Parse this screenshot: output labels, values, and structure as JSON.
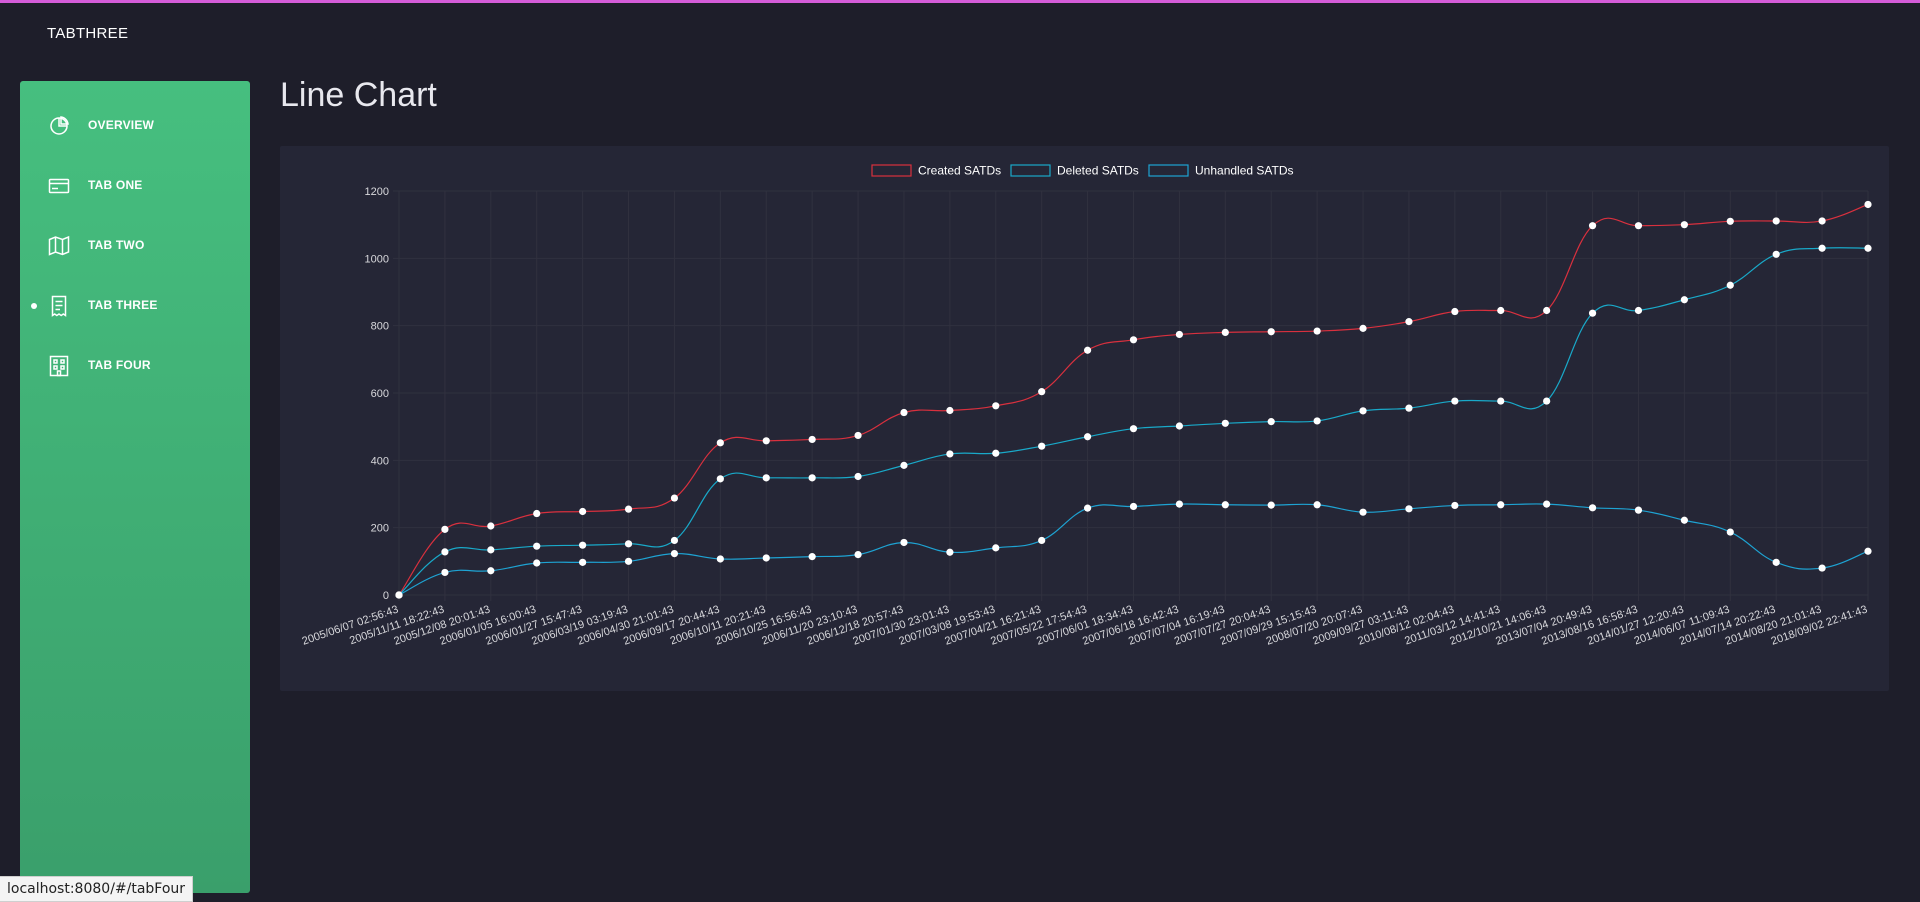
{
  "app": {
    "brand": "TABTHREE"
  },
  "sidebar": {
    "items": [
      {
        "label": "OVERVIEW",
        "icon": "pie-chart-icon",
        "active": false
      },
      {
        "label": "TAB ONE",
        "icon": "credit-card-icon",
        "active": false
      },
      {
        "label": "TAB TWO",
        "icon": "map-icon",
        "active": false
      },
      {
        "label": "TAB THREE",
        "icon": "receipt-icon",
        "active": true
      },
      {
        "label": "TAB FOUR",
        "icon": "building-icon",
        "active": false
      }
    ]
  },
  "main": {
    "title": "Line Chart"
  },
  "statusbar": {
    "url": "localhost:8080/#/tabFour"
  },
  "colors": {
    "background": "#1e1e2a",
    "card": "#252636",
    "sidebar_top": "#46bf7f",
    "sidebar_bottom": "#3a9f6b",
    "created": "#d9303e",
    "deleted": "#19a9c9",
    "unhandled": "#1ea3d3",
    "point": "#ffffff",
    "grid": "#30313f",
    "tick": "#d8d8dc"
  },
  "chart_data": {
    "type": "line",
    "title": "",
    "xlabel": "",
    "ylabel": "",
    "ylim": [
      0,
      1200
    ],
    "y_ticks": [
      0,
      200,
      400,
      600,
      800,
      1000,
      1200
    ],
    "grid": true,
    "legend_position": "top-center",
    "x": [
      "2005/06/07 02:56:43",
      "2005/11/11 18:22:43",
      "2005/12/08 20:01:43",
      "2006/01/05 16:00:43",
      "2006/01/27 15:47:43",
      "2006/03/19 03:19:43",
      "2006/04/30 21:01:43",
      "2006/09/17 20:44:43",
      "2006/10/11 20:21:43",
      "2006/10/25 16:56:43",
      "2006/11/20 23:10:43",
      "2006/12/18 20:57:43",
      "2007/01/30 23:01:43",
      "2007/03/08 19:53:43",
      "2007/04/21 16:21:43",
      "2007/05/22 17:54:43",
      "2007/06/01 18:34:43",
      "2007/06/18 16:42:43",
      "2007/07/04 16:19:43",
      "2007/07/27 20:04:43",
      "2007/09/29 15:15:43",
      "2008/07/20 20:07:43",
      "2009/09/27 03:11:43",
      "2010/08/12 02:04:43",
      "2011/03/12 14:41:43",
      "2012/10/21 14:06:43",
      "2013/07/04 20:49:43",
      "2013/08/16 16:58:43",
      "2014/01/27 12:20:43",
      "2014/06/07 11:09:43",
      "2014/07/14 20:22:43",
      "2014/08/20 21:01:43",
      "2018/09/02 22:41:43"
    ],
    "series": [
      {
        "name": "Created SATDs",
        "color": "#d9303e",
        "values": [
          0,
          195,
          205,
          242,
          248,
          255,
          288,
          452,
          458,
          462,
          474,
          542,
          548,
          562,
          604,
          727,
          758,
          774,
          780,
          782,
          784,
          792,
          812,
          842,
          845,
          845,
          1097,
          1097,
          1100,
          1110,
          1111,
          1111,
          1160
        ]
      },
      {
        "name": "Deleted SATDs",
        "color": "#19a9c9",
        "values": [
          0,
          128,
          134,
          145,
          148,
          152,
          162,
          345,
          348,
          348,
          352,
          385,
          419,
          421,
          442,
          470,
          494,
          502,
          510,
          515,
          517,
          547,
          555,
          576,
          576,
          576,
          837,
          845,
          877,
          920,
          1012,
          1030,
          1030
        ]
      },
      {
        "name": "Unhandled  SATDs",
        "color": "#1ea3d3",
        "values": [
          0,
          67,
          72,
          95,
          97,
          100,
          123,
          107,
          110,
          114,
          120,
          156,
          127,
          140,
          162,
          258,
          263,
          270,
          268,
          267,
          268,
          246,
          256,
          266,
          268,
          270,
          259,
          252,
          222,
          187,
          97,
          80,
          130
        ]
      }
    ]
  }
}
